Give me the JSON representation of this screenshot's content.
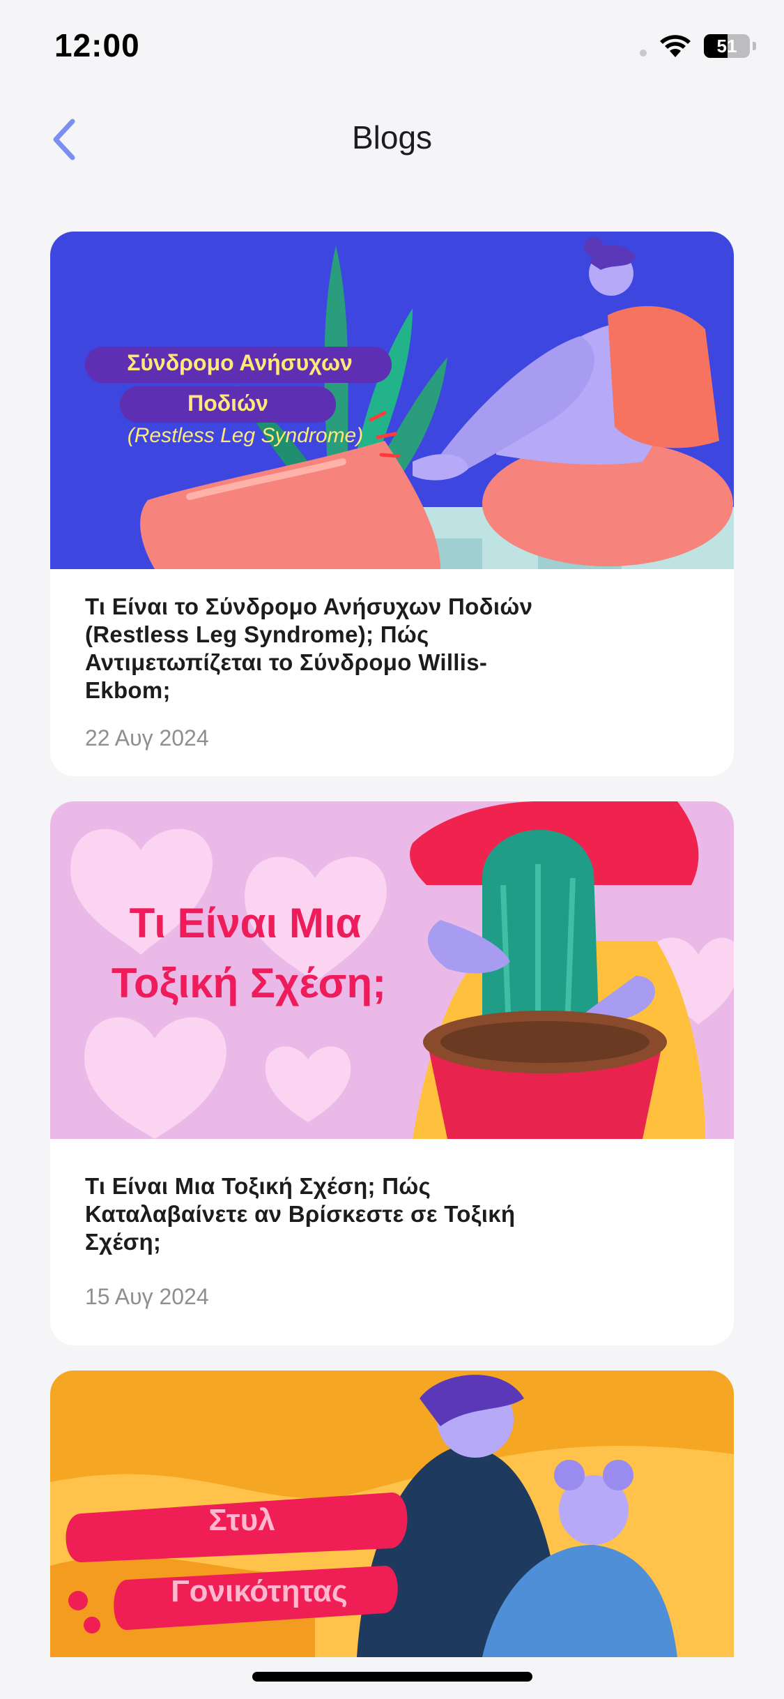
{
  "status_bar": {
    "time": "12:00",
    "battery_level": "51"
  },
  "nav": {
    "title": "Blogs",
    "back_icon": "chevron-left-icon"
  },
  "colors": {
    "accent": "#7b8ff2",
    "background": "#f5f5f7",
    "card": "#ffffff",
    "date": "#8e8e93"
  },
  "posts": [
    {
      "image_text": {
        "line1": "Σύνδρομο Ανήσυχων",
        "line2": "Ποδιών",
        "line3": "(Restless Leg Syndrome)"
      },
      "title": "Τι Είναι το Σύνδρομο Ανήσυχων Ποδιών (Restless Leg Syndrome); Πώς Αντιμετωπίζεται το Σύνδρομο Willis-Ekbom;",
      "date": "22 Αυγ 2024"
    },
    {
      "image_text": {
        "line1": "Τι Είναι Μια",
        "line2": "Τοξική Σχέση;"
      },
      "title": "Τι Είναι Μια Τοξική Σχέση; Πώς Καταλαβαίνετε αν Βρίσκεστε σε Τοξική Σχέση;",
      "date": "15 Αυγ 2024"
    },
    {
      "image_text": {
        "line1": "Στυλ",
        "line2": "Γονικότητας"
      }
    }
  ]
}
